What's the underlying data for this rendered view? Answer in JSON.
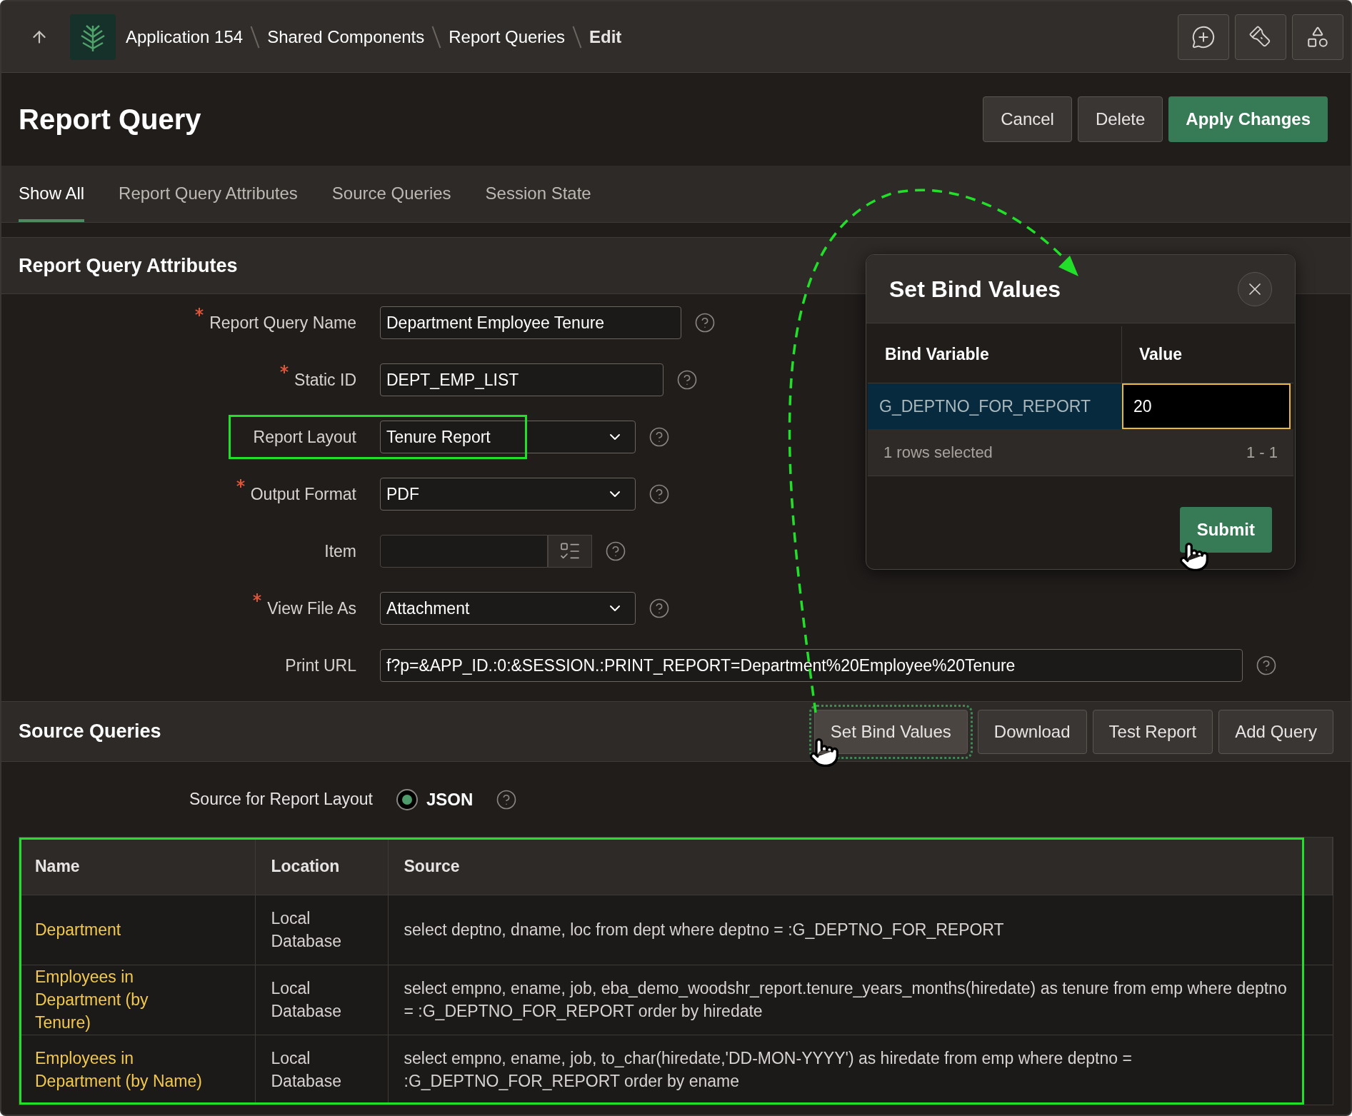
{
  "breadcrumb": [
    {
      "label": "Application 154",
      "current": false
    },
    {
      "label": "Shared Components",
      "current": false
    },
    {
      "label": "Report Queries",
      "current": false
    },
    {
      "label": "Edit",
      "current": true
    }
  ],
  "page_title": "Report Query",
  "header_buttons": [
    {
      "label": "Cancel",
      "kind": "secondary"
    },
    {
      "label": "Delete",
      "kind": "secondary"
    },
    {
      "label": "Apply Changes",
      "kind": "primary"
    }
  ],
  "tabs": [
    {
      "label": "Show All",
      "selected": true
    },
    {
      "label": "Report Query Attributes",
      "selected": false
    },
    {
      "label": "Source Queries",
      "selected": false
    },
    {
      "label": "Session State",
      "selected": false
    }
  ],
  "attributes": {
    "title": "Report Query Attributes",
    "fields": [
      {
        "kind": "text",
        "label": "Report Query Name",
        "required": true,
        "value": "Department Employee Tenure",
        "highlighted": false
      },
      {
        "kind": "text",
        "label": "Static ID",
        "required": true,
        "value": "DEPT_EMP_LIST",
        "highlighted": false
      },
      {
        "kind": "select",
        "label": "Report Layout",
        "required": false,
        "value": "Tenure Report",
        "highlighted": true
      },
      {
        "kind": "select",
        "label": "Output Format",
        "required": true,
        "value": "PDF",
        "highlighted": false
      },
      {
        "kind": "popup",
        "label": "Item",
        "required": false,
        "highlighted": false
      },
      {
        "kind": "select",
        "label": "View File As",
        "required": true,
        "value": "Attachment",
        "highlighted": false
      },
      {
        "kind": "url",
        "label": "Print URL",
        "required": false,
        "value": "f?p=&APP_ID.:0:&SESSION.:PRINT_REPORT=Department%20Employee%20Tenure",
        "highlighted": false
      }
    ]
  },
  "source_queries": {
    "title": "Source Queries",
    "buttons": [
      {
        "label": "Set Bind Values",
        "focused": true
      },
      {
        "label": "Download",
        "focused": false
      },
      {
        "label": "Test Report",
        "focused": false
      },
      {
        "label": "Add Query",
        "focused": false
      }
    ],
    "layout_source": {
      "label": "Source for Report Layout",
      "option": "JSON",
      "selected": true
    },
    "table": {
      "highlighted": true,
      "columns": [
        "Name",
        "Location",
        "Source"
      ],
      "rows": [
        {
          "name": "Department",
          "location": "Local Database",
          "source": "select deptno, dname, loc from dept where deptno = :G_DEPTNO_FOR_REPORT"
        },
        {
          "name": "Employees in Department (by Tenure)",
          "location": "Local Database",
          "source": "select empno, ename, job, eba_demo_woodshr_report.tenure_years_months(hiredate) as tenure from emp where deptno = :G_DEPTNO_FOR_REPORT order by hiredate"
        },
        {
          "name": "Employees in Department (by Name)",
          "location": "Local Database",
          "source": "select empno, ename, job, to_char(hiredate,'DD-MON-YYYY') as hiredate from emp where deptno = :G_DEPTNO_FOR_REPORT order by ename"
        }
      ]
    }
  },
  "dialog": {
    "title": "Set Bind Values",
    "columns": [
      "Bind Variable",
      "Value"
    ],
    "rows": [
      {
        "variable": "G_DEPTNO_FOR_REPORT",
        "value": "20",
        "selected": true
      }
    ],
    "status": "1 rows selected",
    "range": "1 - 1",
    "submit": "Submit"
  }
}
